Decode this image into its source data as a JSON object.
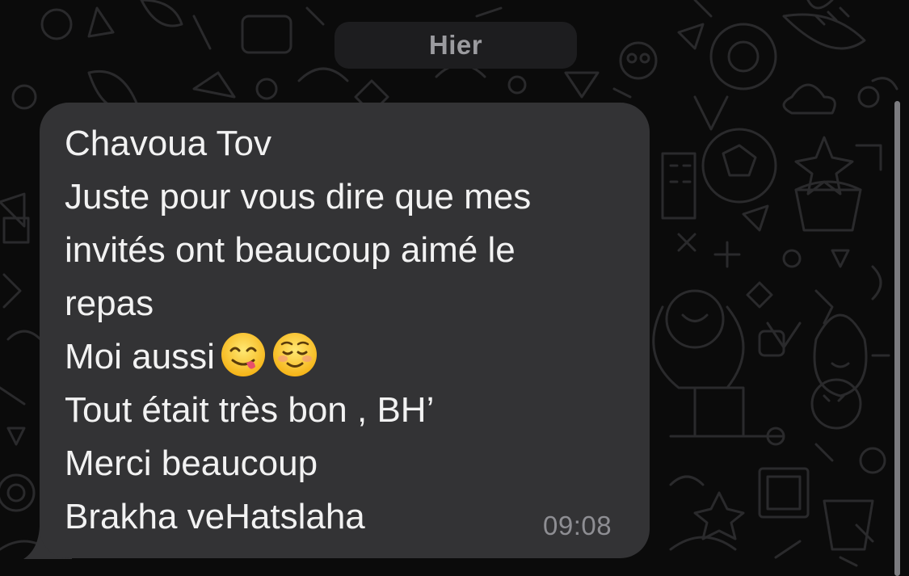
{
  "date_separator": "Hier",
  "message": {
    "lines": [
      "Chavoua Tov",
      "Juste pour vous dire que mes",
      "invités ont beaucoup aimé le",
      "repas",
      "Moi aussi",
      "Tout était très bon , BH’",
      "Merci beaucoup",
      "Brakha veHatslaha"
    ],
    "emojis": [
      "face-savoring-food-emoji",
      "smiling-face-emoji"
    ],
    "time": "09:08"
  },
  "colors": {
    "background": "#0b0b0b",
    "bubble": "#333335",
    "text": "#f2f2f2",
    "secondary_text": "#8e8e93"
  }
}
